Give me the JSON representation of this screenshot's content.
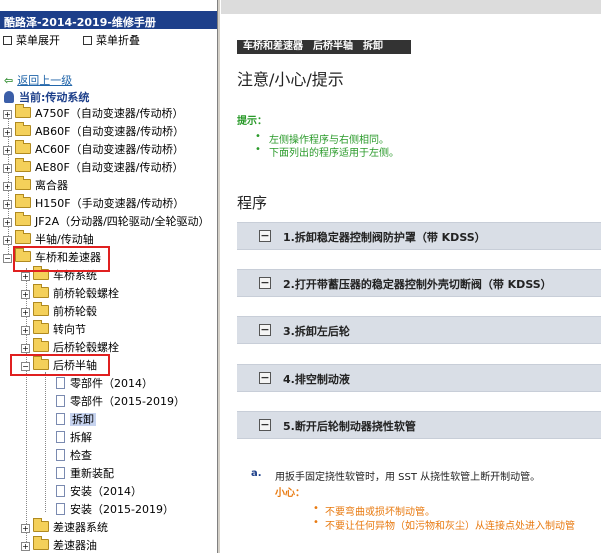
{
  "sidebar": {
    "app_title": "酷路泽-2014-2019-维修手册",
    "expand_label": "菜单展开",
    "collapse_label": "菜单折叠",
    "back_label": "返回上一级",
    "current_label": "当前:传动系统",
    "tree": [
      {
        "label": "A750F（自动变速器/传动桥）"
      },
      {
        "label": "AB60F（自动变速器/传动桥）"
      },
      {
        "label": "AC60F（自动变速器/传动桥）"
      },
      {
        "label": "AE80F（自动变速器/传动桥）"
      },
      {
        "label": "离合器"
      },
      {
        "label": "H150F（手动变速器/传动桥）"
      },
      {
        "label": "JF2A（分动器/四轮驱动/全轮驱动）"
      },
      {
        "label": "半轴/传动轴"
      },
      {
        "label": "车桥和差速器"
      },
      {
        "label": "车桥系统"
      },
      {
        "label": "前桥轮毂螺栓"
      },
      {
        "label": "前桥轮毂"
      },
      {
        "label": "转向节"
      },
      {
        "label": "后桥轮毂螺栓"
      },
      {
        "label": "后桥半轴"
      },
      {
        "label": "零部件（2014）"
      },
      {
        "label": "零部件（2015-2019）"
      },
      {
        "label": "拆卸"
      },
      {
        "label": "拆解"
      },
      {
        "label": "检查"
      },
      {
        "label": "重新装配"
      },
      {
        "label": "安装（2014）"
      },
      {
        "label": "安装（2015-2019）"
      },
      {
        "label": "差速器系统"
      },
      {
        "label": "差速器油"
      }
    ]
  },
  "main": {
    "breadcrumb": "车桥和差速器　后桥半轴　拆卸",
    "title": "注意/小心/提示",
    "hint_label": "提示：",
    "hints": [
      "左侧操作程序与右侧相同。",
      "下面列出的程序适用于左侧。"
    ],
    "procedure_title": "程序",
    "steps": [
      {
        "label": "1.拆卸稳定器控制阀防护罩（带 KDSS）"
      },
      {
        "label": "2.打开带蓄压器的稳定器控制外壳切断阀（带 KDSS）"
      },
      {
        "label": "3.拆卸左后轮"
      },
      {
        "label": "4.排空制动液"
      },
      {
        "label": "5.断开后轮制动器挠性软管"
      }
    ],
    "step5": {
      "a_label": "a.",
      "a_text": "用扳手固定挠性软管时，用 SST 从挠性软管上断开制动管。",
      "caution_label": "小心：",
      "cautions": [
        "不要弯曲或损坏制动管。",
        "不要让任何异物（如污物和灰尘）从连接点处进入制动管"
      ]
    }
  }
}
